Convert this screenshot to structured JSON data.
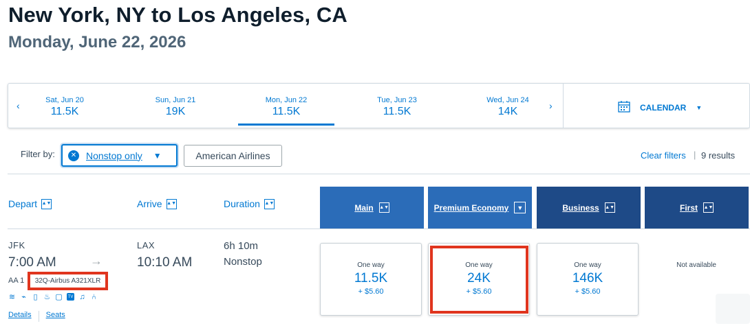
{
  "header": {
    "title": "New York, NY to Los Angeles, CA",
    "subtitle": "Monday, June 22, 2026"
  },
  "date_strip": {
    "days": [
      {
        "label": "Sat, Jun 20",
        "value": "11.5K",
        "selected": false
      },
      {
        "label": "Sun, Jun 21",
        "value": "19K",
        "selected": false
      },
      {
        "label": "Mon, Jun 22",
        "value": "11.5K",
        "selected": true
      },
      {
        "label": "Tue, Jun 23",
        "value": "11.5K",
        "selected": false
      },
      {
        "label": "Wed, Jun 24",
        "value": "14K",
        "selected": false
      }
    ],
    "calendar_label": "CALENDAR"
  },
  "filters": {
    "label": "Filter by:",
    "active_filter": "Nonstop only",
    "airline_filter": "American Airlines",
    "clear_label": "Clear filters",
    "separator": "|",
    "results": "9 results"
  },
  "columns": {
    "depart": "Depart",
    "arrive": "Arrive",
    "duration": "Duration"
  },
  "cabins": [
    {
      "label": "Main",
      "color": "#2b6cb8"
    },
    {
      "label": "Premium Economy",
      "color": "#2b6cb8"
    },
    {
      "label": "Business",
      "color": "#1e4a87"
    },
    {
      "label": "First",
      "color": "#1e4a87"
    }
  ],
  "flight": {
    "depart_code": "JFK",
    "depart_time": "7:00 AM",
    "arrive_code": "LAX",
    "arrive_time": "10:10 AM",
    "flight_number": "AA 1",
    "aircraft": "32Q-Airbus A321XLR",
    "duration": "6h 10m",
    "stops": "Nonstop",
    "details_link": "Details",
    "seats_link": "Seats",
    "amenities": [
      "wifi-icon",
      "power-icon",
      "usb-icon",
      "meal-icon",
      "device-icon",
      "tv-icon",
      "entertainment-icon",
      "seat-icon"
    ],
    "fares": [
      {
        "label": "One way",
        "price": "11.5K",
        "taxes": "+ $5.60"
      },
      {
        "label": "One way",
        "price": "24K",
        "taxes": "+ $5.60"
      },
      {
        "label": "One way",
        "price": "146K",
        "taxes": "+ $5.60"
      }
    ],
    "first_fare": "Not available"
  },
  "colors": {
    "accent": "#0078d2",
    "highlight": "#e0351e"
  }
}
